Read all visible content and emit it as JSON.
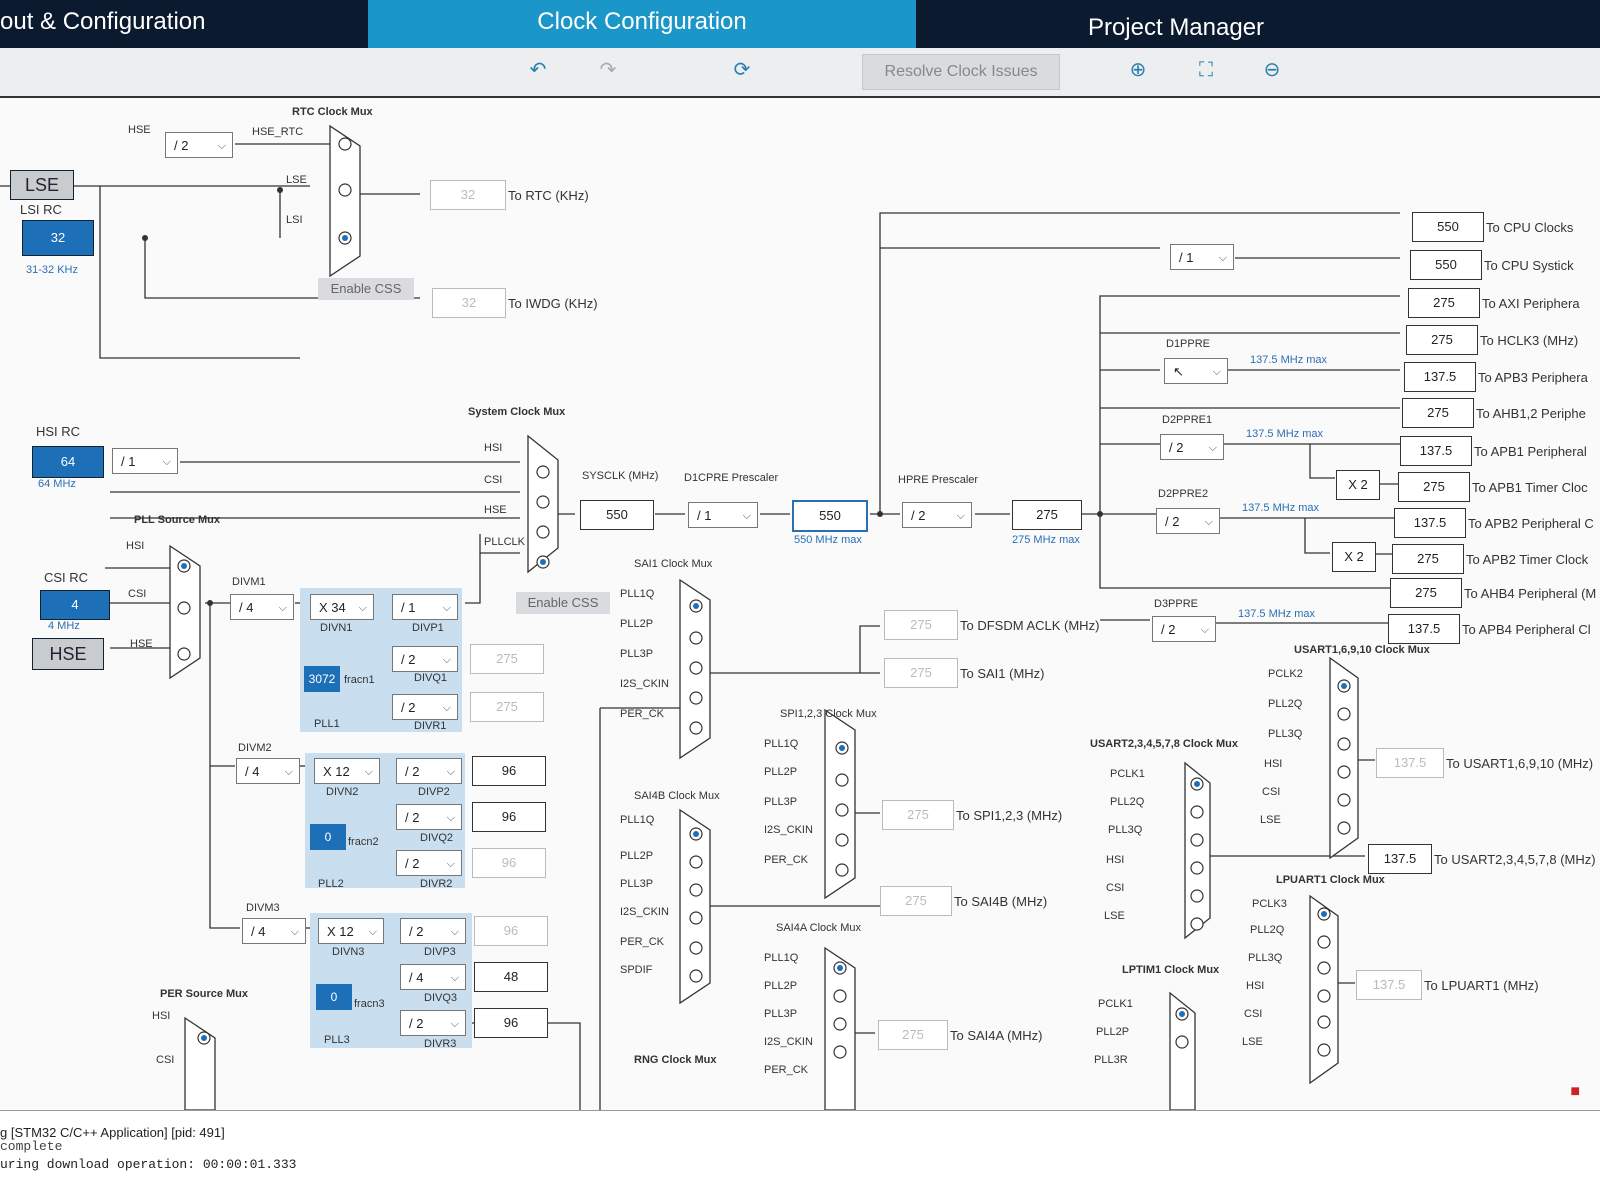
{
  "tabs": {
    "pinout": "out & Configuration",
    "clock": "Clock Configuration",
    "project": "Project Manager"
  },
  "toolbar": {
    "resolve": "Resolve Clock Issues"
  },
  "rtc": {
    "mux_title": "RTC Clock Mux",
    "hse": "HSE",
    "hse_div": "/ 2",
    "hse_rtc": "HSE_RTC",
    "lse_in": "LSE",
    "lsi_in": "LSI",
    "out_val": "32",
    "out_label": "To RTC (KHz)",
    "enable_css": "Enable CSS",
    "iwdg_val": "32",
    "iwdg_label": "To IWDG (KHz)"
  },
  "lse": {
    "label": "LSE"
  },
  "lsi": {
    "title": "LSI RC",
    "value": "32",
    "range": "31-32 KHz"
  },
  "hsi": {
    "title": "HSI RC",
    "value": "64",
    "freq": "64 MHz",
    "div": "/ 1"
  },
  "csi": {
    "title": "CSI RC",
    "value": "4",
    "freq": "4 MHz"
  },
  "hse": {
    "label": "HSE"
  },
  "pllsrc": {
    "title": "PLL Source Mux",
    "hsi": "HSI",
    "csi": "CSI",
    "hse": "HSE"
  },
  "sysmux": {
    "title": "System Clock Mux",
    "hsi": "HSI",
    "csi": "CSI",
    "hse": "HSE",
    "pllclk": "PLLCLK",
    "enable_css": "Enable CSS"
  },
  "sysclk": {
    "label": "SYSCLK (MHz)",
    "value": "550"
  },
  "d1cpre": {
    "label": "D1CPRE Prescaler",
    "div": "/ 1",
    "value": "550",
    "max": "550 MHz max"
  },
  "hpre": {
    "label": "HPRE Prescaler",
    "div": "/ 2",
    "value": "275",
    "max": "275 MHz max"
  },
  "pll1": {
    "divm_label": "DIVM1",
    "divm": "/ 4",
    "divn": "X 34",
    "divn_label": "DIVN1",
    "divp": "/ 1",
    "divp_label": "DIVP1",
    "divq": "/ 2",
    "divq_label": "DIVQ1",
    "divq_val": "275",
    "divr": "/ 2",
    "divr_label": "DIVR1",
    "divr_val": "275",
    "frac": "3072",
    "frac_label": "fracn1",
    "name": "PLL1"
  },
  "pll2": {
    "divm_label": "DIVM2",
    "divm": "/ 4",
    "divn": "X 12",
    "divn_label": "DIVN2",
    "divp": "/ 2",
    "divp_label": "DIVP2",
    "divp_val": "96",
    "divq": "/ 2",
    "divq_label": "DIVQ2",
    "divq_val": "96",
    "divr": "/ 2",
    "divr_label": "DIVR2",
    "divr_val": "96",
    "frac": "0",
    "frac_label": "fracn2",
    "name": "PLL2"
  },
  "pll3": {
    "divm_label": "DIVM3",
    "divm": "/ 4",
    "divn": "X 12",
    "divn_label": "DIVN3",
    "divp": "/ 2",
    "divp_label": "DIVP3",
    "divp_val": "96",
    "divq": "/ 4",
    "divq_label": "DIVQ3",
    "divq_val": "48",
    "divr": "/ 2",
    "divr_label": "DIVR3",
    "divr_val": "96",
    "frac": "0",
    "frac_label": "fracn3",
    "name": "PLL3"
  },
  "persrc": {
    "title": "PER Source Mux",
    "hsi": "HSI",
    "csi": "CSI"
  },
  "sai1": {
    "title": "SAI1 Clock Mux",
    "in": [
      "PLL1Q",
      "PLL2P",
      "PLL3P",
      "I2S_CKIN",
      "PER_CK"
    ],
    "dfsdm_val": "275",
    "dfsdm_label": "To DFSDM ACLK (MHz)",
    "sai1_val": "275",
    "sai1_label": "To SAI1 (MHz)"
  },
  "spi123": {
    "title": "SPI1,2,3 Clock Mux",
    "in": [
      "PLL1Q",
      "PLL2P",
      "PLL3P",
      "I2S_CKIN",
      "PER_CK"
    ],
    "val": "275",
    "label": "To SPI1,2,3 (MHz)"
  },
  "sai4b": {
    "title": "SAI4B Clock Mux",
    "in": [
      "PLL1Q",
      "PLL2P",
      "PLL3P",
      "I2S_CKIN",
      "PER_CK",
      "SPDIF"
    ],
    "val": "275",
    "label": "To SAI4B (MHz)"
  },
  "sai4a": {
    "title": "SAI4A Clock Mux",
    "in": [
      "PLL1Q",
      "PLL2P",
      "PLL3P",
      "I2S_CKIN",
      "PER_CK"
    ],
    "val": "275",
    "label": "To SAI4A (MHz)"
  },
  "rng": {
    "title": "RNG Clock Mux"
  },
  "outputs": {
    "cpu": {
      "val": "550",
      "label": "To CPU Clocks"
    },
    "systick": {
      "div": "/ 1",
      "val": "550",
      "label": "To CPU Systick"
    },
    "axi": {
      "val": "275",
      "label": "To AXI Periphera"
    },
    "hclk3": {
      "val": "275",
      "label": "To HCLK3 (MHz)"
    },
    "d1ppre": {
      "label": "D1PPRE",
      "max": "137.5 MHz max"
    },
    "apb3": {
      "val": "137.5",
      "label": "To APB3 Periphera"
    },
    "ahb12": {
      "val": "275",
      "label": "To AHB1,2 Periphe"
    },
    "d2ppre1": {
      "label": "D2PPRE1",
      "div": "/ 2",
      "max": "137.5 MHz max"
    },
    "apb1": {
      "val": "137.5",
      "label": "To APB1 Peripheral"
    },
    "apb1t": {
      "mult": "X 2",
      "val": "275",
      "label": "To APB1 Timer Cloc"
    },
    "d2ppre2": {
      "label": "D2PPRE2",
      "div": "/ 2",
      "max": "137.5 MHz max"
    },
    "apb2": {
      "val": "137.5",
      "label": "To APB2 Peripheral C"
    },
    "apb2t": {
      "mult": "X 2",
      "val": "275",
      "label": "To APB2 Timer Clock"
    },
    "ahb4": {
      "val": "275",
      "label": "To AHB4 Peripheral (M"
    },
    "d3ppre": {
      "label": "D3PPRE",
      "div": "/ 2",
      "max": "137.5 MHz max"
    },
    "apb4": {
      "val": "137.5",
      "label": "To APB4 Peripheral Cl"
    }
  },
  "usart16": {
    "title": "USART1,6,9,10 Clock Mux",
    "in": [
      "PCLK2",
      "PLL2Q",
      "PLL3Q",
      "HSI",
      "CSI",
      "LSE"
    ],
    "val": "137.5",
    "label": "To USART1,6,9,10 (MHz)"
  },
  "usart2": {
    "title": "USART2,3,4,5,7,8 Clock Mux",
    "in": [
      "PCLK1",
      "PLL2Q",
      "PLL3Q",
      "HSI",
      "CSI",
      "LSE"
    ],
    "val": "137.5",
    "label": "To USART2,3,4,5,7,8 (MHz)"
  },
  "lpuart": {
    "title": "LPUART1 Clock Mux",
    "in": [
      "PCLK3",
      "PLL2Q",
      "PLL3Q",
      "HSI",
      "CSI",
      "LSE"
    ],
    "val": "137.5",
    "label": "To LPUART1 (MHz)"
  },
  "lptim": {
    "title": "LPTIM1 Clock Mux",
    "in": [
      "PCLK1",
      "PLL2P",
      "PLL3R"
    ]
  },
  "console": {
    "line1": "g [STM32 C/C++ Application] [pid: 491]",
    "line2": "complete",
    "line3": "uring download operation: 00:00:01.333"
  },
  "icons": [
    "undo-icon",
    "redo-icon",
    "refresh-icon",
    "zoom-in-icon",
    "fit-icon",
    "zoom-out-icon"
  ]
}
